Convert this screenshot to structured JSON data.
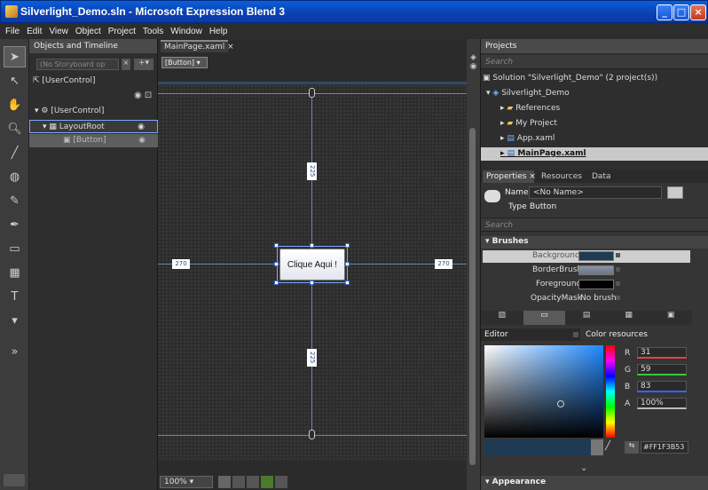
{
  "window": {
    "title": "Silverlight_Demo.sln - Microsoft Expression Blend 3",
    "min": "_",
    "max": "□",
    "close": "×"
  },
  "menu": [
    "File",
    "Edit",
    "View",
    "Object",
    "Project",
    "Tools",
    "Window",
    "Help"
  ],
  "objects_panel": {
    "title": "Objects and Timeline",
    "storyboard_placeholder": "(No Storyboard op",
    "scope": "[UserControl]",
    "tree": [
      {
        "label": "[UserControl]",
        "indent": 0
      },
      {
        "label": "LayoutRoot",
        "indent": 1
      },
      {
        "label": "[Button]",
        "indent": 2
      }
    ]
  },
  "document": {
    "tab": "MainPage.xaml",
    "breadcrumb": "[Button]",
    "button_label": "Clique Aqui !",
    "margins": {
      "top": "225",
      "bottom": "225",
      "left": "270",
      "right": "270"
    },
    "zoom": "100%"
  },
  "projects_panel": {
    "title": "Projects",
    "search_placeholder": "Search",
    "items": [
      {
        "label": "Solution \"Silverlight_Demo\" (2 project(s))",
        "icon": "solution-icon"
      },
      {
        "label": "Silverlight_Demo",
        "icon": "project-icon"
      },
      {
        "label": "References",
        "icon": "folder-icon"
      },
      {
        "label": "My Project",
        "icon": "folder-icon"
      },
      {
        "label": "App.xaml",
        "icon": "xaml-file-icon"
      },
      {
        "label": "MainPage.xaml",
        "icon": "xaml-file-icon"
      }
    ]
  },
  "properties_panel": {
    "tabs": [
      "Properties",
      "Resources",
      "Data"
    ],
    "name_label": "Name",
    "name_value": "<No Name>",
    "type_label": "Type",
    "type_value": "Button",
    "search_placeholder": "Search",
    "section_brushes": "Brushes",
    "brushes": [
      {
        "label": "Background",
        "value": "",
        "color": "#1F3B53"
      },
      {
        "label": "BorderBrush",
        "value": "",
        "color": "#7E8A9A"
      },
      {
        "label": "Foreground",
        "value": "",
        "color": "#000000"
      },
      {
        "label": "OpacityMask",
        "value": "No brush",
        "color": ""
      }
    ],
    "editor_tab": "Editor",
    "color_resources_tab": "Color resources",
    "rgba": [
      {
        "label": "R",
        "value": "31"
      },
      {
        "label": "G",
        "value": "59"
      },
      {
        "label": "B",
        "value": "83"
      },
      {
        "label": "A",
        "value": "100%"
      }
    ],
    "hex": "#FF1F3B53",
    "section_appearance": "Appearance"
  }
}
